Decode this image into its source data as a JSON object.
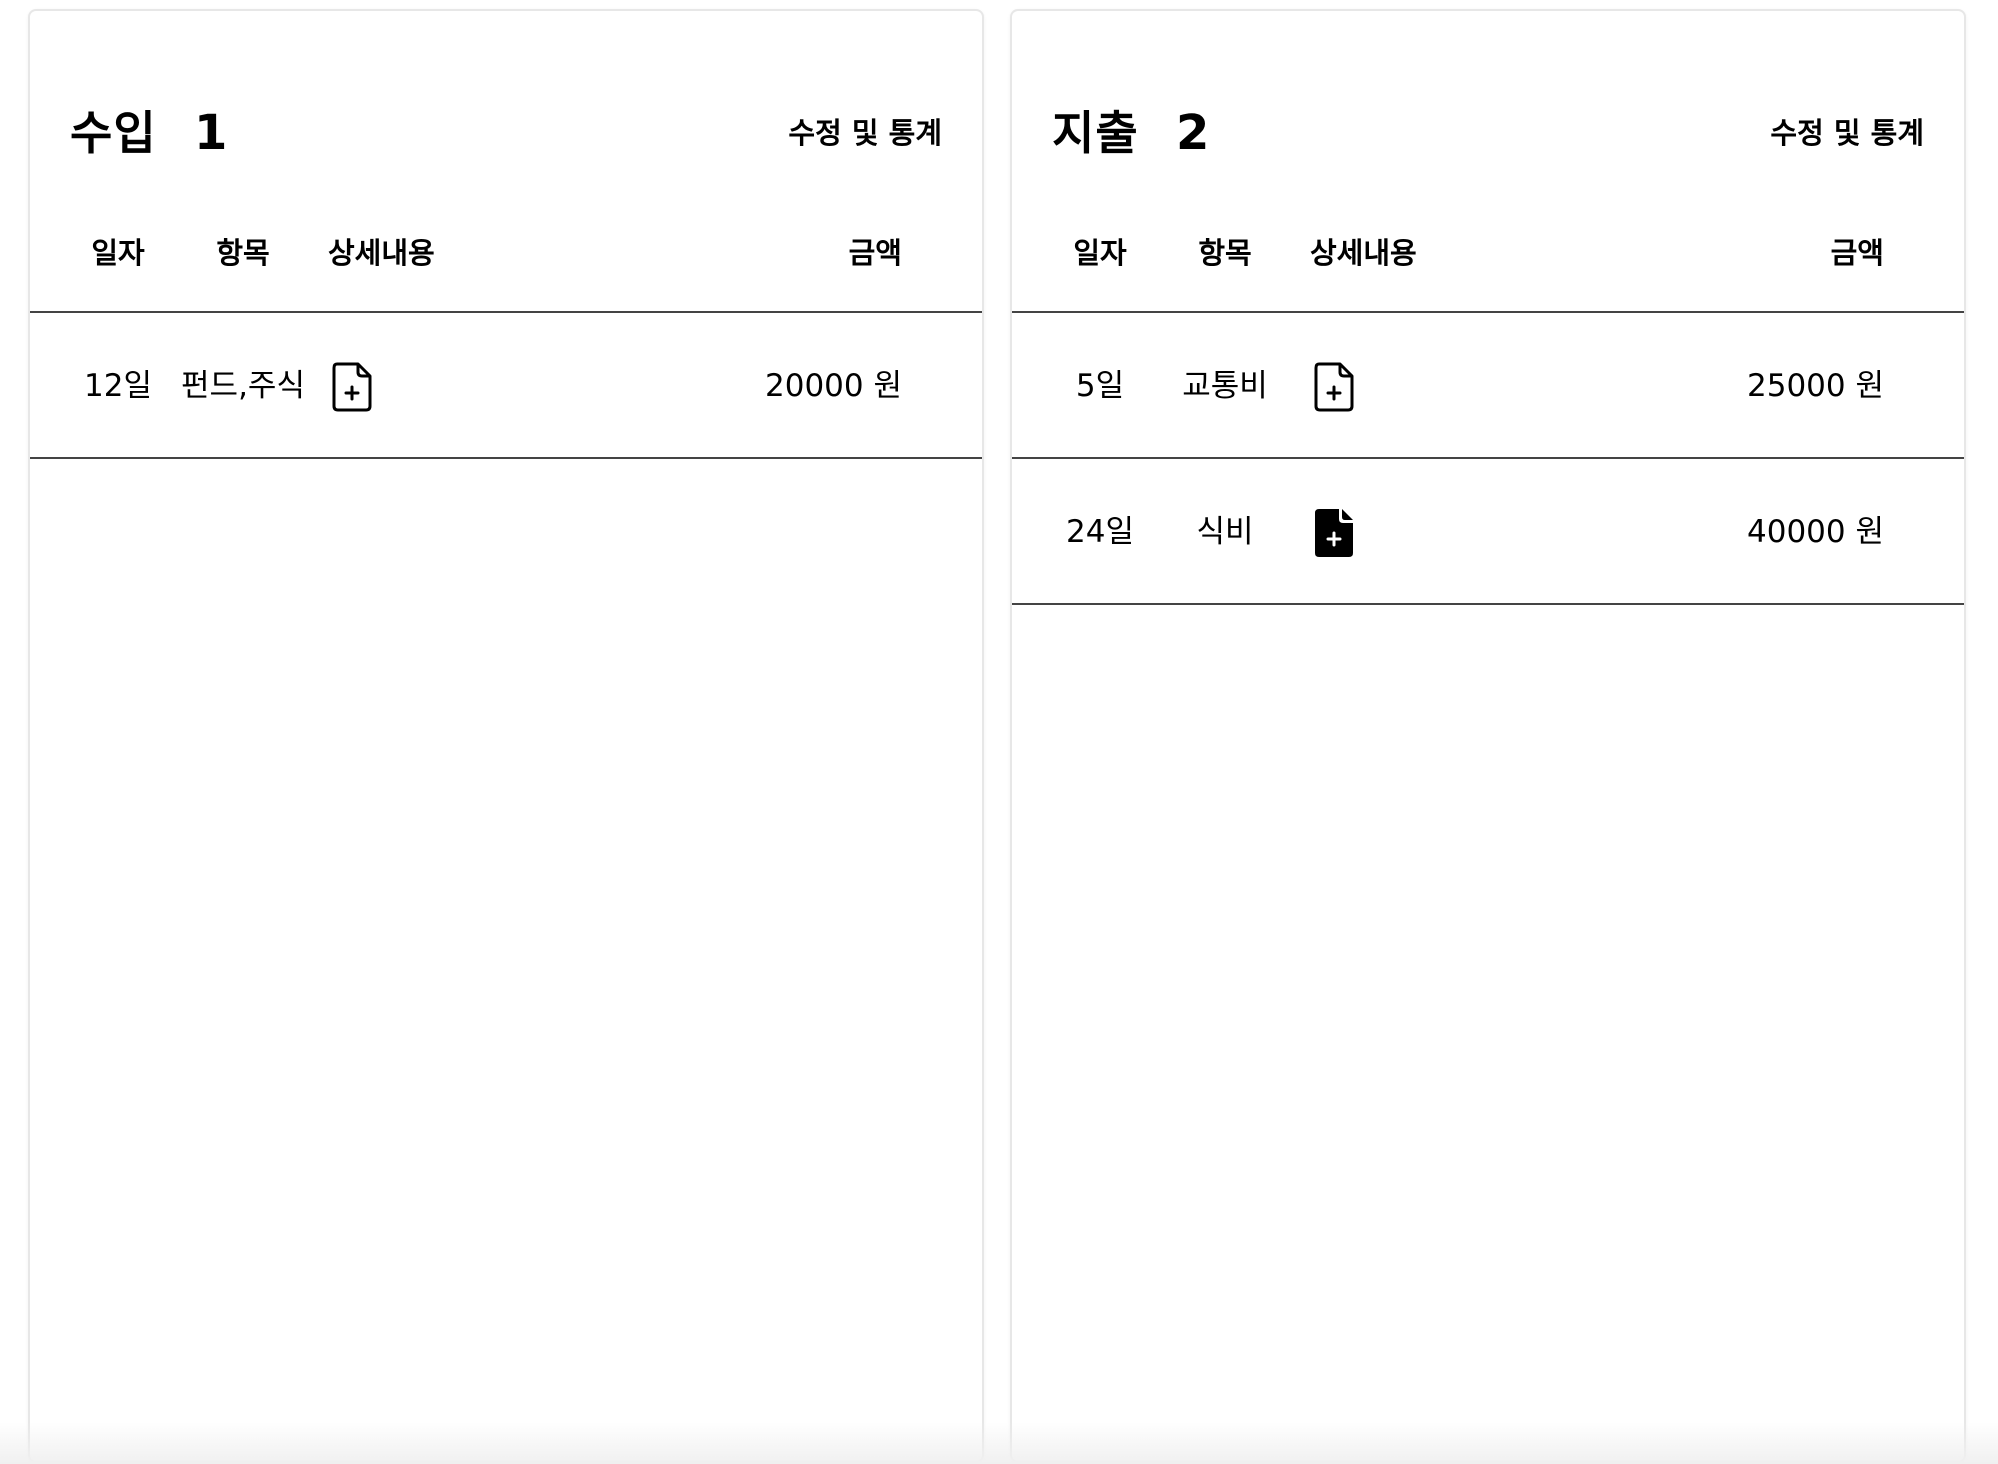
{
  "income": {
    "title": "수입",
    "count": "1",
    "edit_label": "수정 및 통계",
    "columns": {
      "date": "일자",
      "category": "항목",
      "detail": "상세내용",
      "amount": "금액"
    },
    "rows": [
      {
        "date": "12일",
        "category": "펀드,주식",
        "detail_icon": "file-plus-icon",
        "amount": "20000 원"
      }
    ]
  },
  "expense": {
    "title": "지출",
    "count": "2",
    "edit_label": "수정 및 통계",
    "columns": {
      "date": "일자",
      "category": "항목",
      "detail": "상세내용",
      "amount": "금액"
    },
    "rows": [
      {
        "date": "5일",
        "category": "교통비",
        "detail_icon": "file-plus-icon",
        "amount": "25000 원"
      },
      {
        "date": "24일",
        "category": "식비",
        "detail_icon": "file-plus-filled-icon",
        "amount": "40000 원"
      }
    ]
  },
  "colors": {
    "text": "#000000",
    "panel_border": "#e7e7e7",
    "row_divider": "#444444",
    "background": "#ffffff"
  }
}
